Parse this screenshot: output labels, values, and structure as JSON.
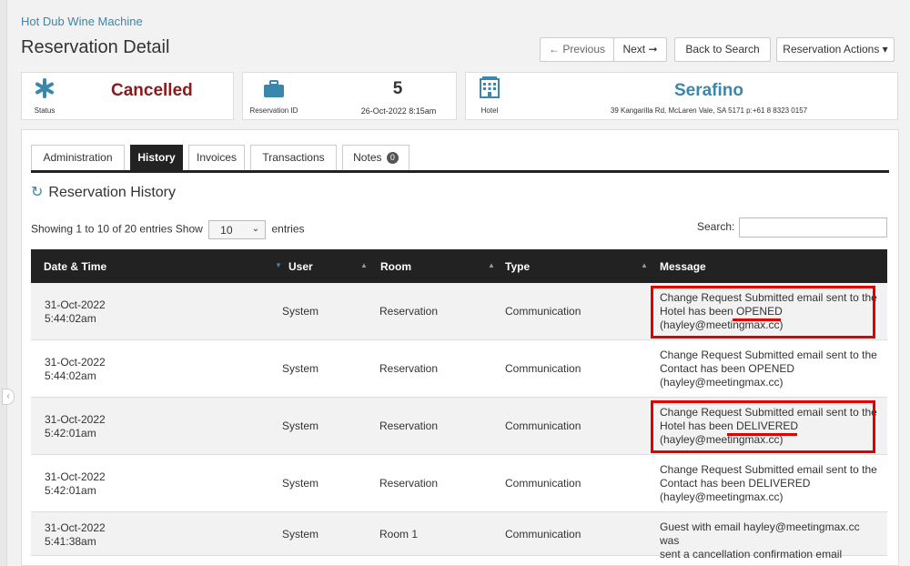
{
  "header": {
    "app_name": "Hot Dub Wine Machine",
    "page_title": "Reservation Detail",
    "prev_label": "← Previous",
    "next_label": "Next ➞",
    "back_label": "Back to Search",
    "actions_label": "Reservation Actions ▾"
  },
  "cards": {
    "status": {
      "icon": "asterisk-icon",
      "label": "Status",
      "value": "Cancelled"
    },
    "reservation": {
      "icon": "briefcase-icon",
      "label": "Reservation ID",
      "value": "5",
      "date": "26-Oct-2022 8:15am"
    },
    "hotel": {
      "icon": "building-icon",
      "label": "Hotel",
      "name": "Serafino",
      "address": "39 Kangarilla Rd, McLaren Vale, SA 5171 p:+61 8 8323 0157"
    }
  },
  "tabs": [
    {
      "label": "Administration",
      "active": false
    },
    {
      "label": "History",
      "active": true
    },
    {
      "label": "Invoices",
      "active": false
    },
    {
      "label": "Transactions",
      "active": false
    },
    {
      "label": "Notes",
      "active": false,
      "badge": "0"
    }
  ],
  "history": {
    "title": "Reservation History",
    "showing": "Showing 1 to 10 of 20 entries",
    "show_label": "Show",
    "page_length": "10",
    "entries_label": "entries",
    "search_label": "Search:",
    "search_value": "",
    "columns": [
      "Date & Time",
      "User",
      "Room",
      "Type",
      "Message"
    ],
    "rows": [
      {
        "date": "31-Oct-2022",
        "time": "5:44:02am",
        "user": "System",
        "room": "Reservation",
        "type": "Communication",
        "msg1": "Change Request Submitted email sent to the",
        "msg2": "Hotel has been OPENED",
        "msg3": "(hayley@meetingmax.cc)"
      },
      {
        "date": "31-Oct-2022",
        "time": "5:44:02am",
        "user": "System",
        "room": "Reservation",
        "type": "Communication",
        "msg1": "Change Request Submitted email sent to the",
        "msg2": "Contact has been OPENED",
        "msg3": "(hayley@meetingmax.cc)"
      },
      {
        "date": "31-Oct-2022",
        "time": "5:42:01am",
        "user": "System",
        "room": "Reservation",
        "type": "Communication",
        "msg1": "Change Request Submitted email sent to the",
        "msg2": "Hotel has been DELIVERED",
        "msg3": "(hayley@meetingmax.cc)"
      },
      {
        "date": "31-Oct-2022",
        "time": "5:42:01am",
        "user": "System",
        "room": "Reservation",
        "type": "Communication",
        "msg1": "Change Request Submitted email sent to the",
        "msg2": "Contact has been DELIVERED",
        "msg3": "(hayley@meetingmax.cc)"
      },
      {
        "date": "31-Oct-2022",
        "time": "5:41:38am",
        "user": "System",
        "room": "Room 1",
        "type": "Communication",
        "msg1": "Guest with email hayley@meetingmax.cc was",
        "msg2": "sent a cancellation confirmation email",
        "msg3": ""
      }
    ]
  },
  "colors": {
    "accent": "#3a87ad",
    "status": "#8b1a1a",
    "header_bg": "#222222",
    "highlight": "#e00000"
  }
}
